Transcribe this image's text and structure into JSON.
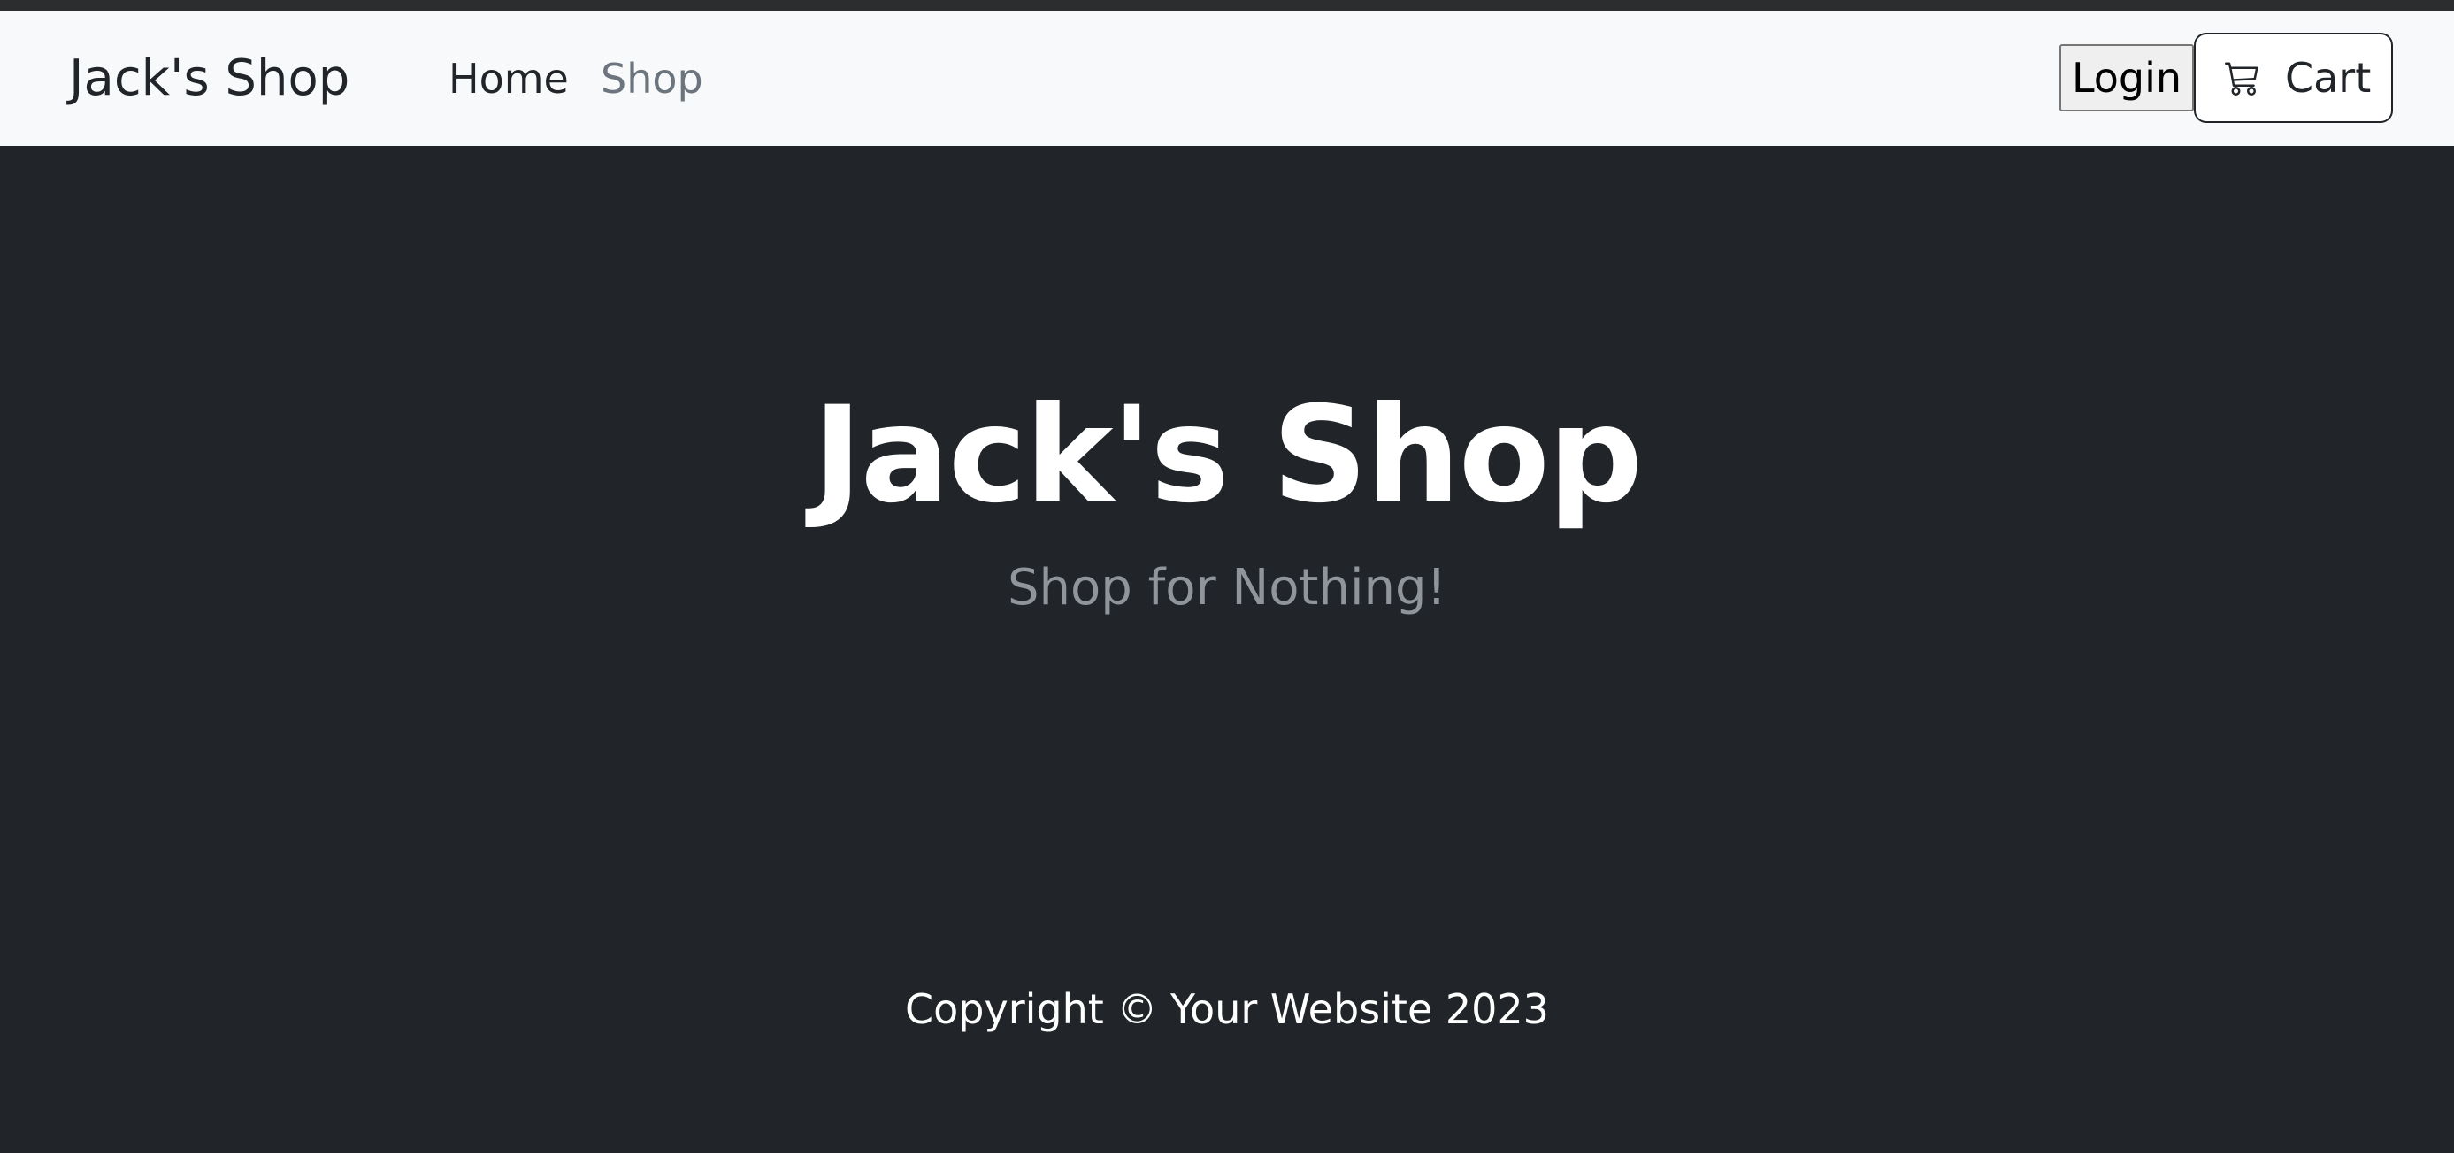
{
  "navbar": {
    "brand": "Jack's Shop",
    "links": [
      {
        "label": "Home",
        "active": true
      },
      {
        "label": "Shop",
        "active": false
      }
    ],
    "login_label": "Login",
    "cart": {
      "label": "Cart",
      "icon": "cart-icon"
    }
  },
  "hero": {
    "title": "Jack's Shop",
    "subtitle": "Shop for Nothing!"
  },
  "footer": {
    "copyright": "Copyright © Your Website 2023"
  },
  "colors": {
    "navbar_bg": "#f8f9fa",
    "dark_bg": "#212529",
    "muted_text": "#6c757d"
  }
}
